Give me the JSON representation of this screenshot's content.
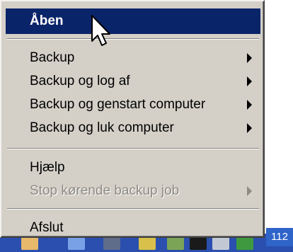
{
  "menu": {
    "items": [
      {
        "label": "Åben"
      },
      {
        "label": "Backup"
      },
      {
        "label": "Backup og log af"
      },
      {
        "label": "Backup og genstart computer"
      },
      {
        "label": "Backup og luk computer"
      },
      {
        "label": "Hjælp"
      },
      {
        "label": "Stop kørende backup job"
      },
      {
        "label": "Afslut"
      }
    ]
  },
  "taskbar": {
    "clock_text": "112"
  },
  "colors": {
    "menu_bg": "#d4d0c8",
    "selected_bg": "#0a246a",
    "disabled_text": "#8e8b84",
    "taskbar_bg": "#2a4fae"
  },
  "icons": {
    "cursor": "arrow-cursor-icon",
    "submenu": "submenu-arrow-icon"
  }
}
